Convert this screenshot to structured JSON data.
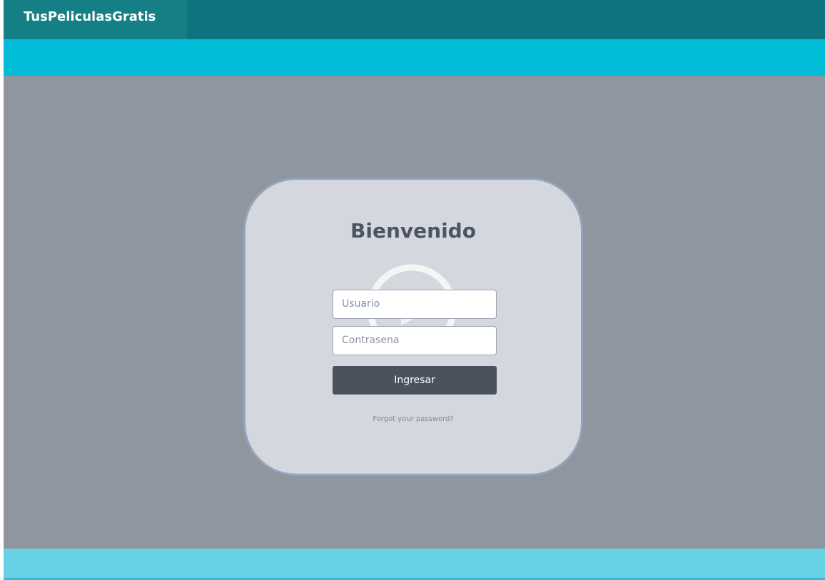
{
  "header": {
    "brand": "TusPeliculasGratis"
  },
  "login": {
    "title": "Bienvenido",
    "username_placeholder": "Usuario",
    "password_placeholder": "Contrasena",
    "submit_label": "Ingresar",
    "forgot_label": "Forgot your password?"
  },
  "colors": {
    "topbar": "#0f737f",
    "brand_bg": "#148085",
    "cyan_bar": "#00bcd6",
    "main_bg": "#8f96a0",
    "card_bg": "#d4d7de",
    "button_bg": "#4a525e",
    "footer_bg": "#66d1e3"
  },
  "icons": {
    "background_watermark": "play-circle-icon"
  }
}
